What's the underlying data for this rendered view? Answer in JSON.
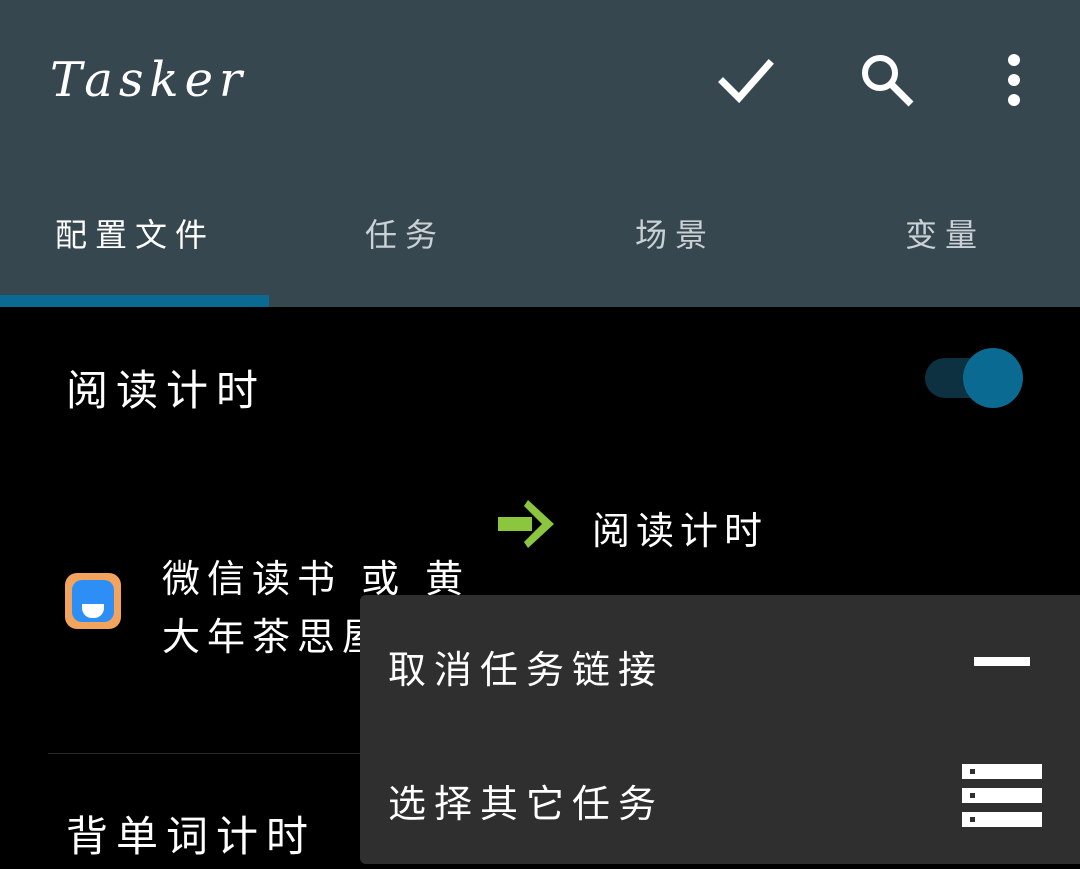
{
  "appbar": {
    "title": "Tasker",
    "actions": [
      {
        "name": "confirm",
        "icon": "check-icon"
      },
      {
        "name": "search",
        "icon": "search-icon"
      },
      {
        "name": "more",
        "icon": "more-vert-icon"
      }
    ],
    "bg_color": "#37474f"
  },
  "tabs": [
    {
      "label": "配置文件",
      "active": true
    },
    {
      "label": "任务",
      "active": false
    },
    {
      "label": "场景",
      "active": false
    },
    {
      "label": "变量",
      "active": false
    }
  ],
  "accent_color": "#0a6a92",
  "profiles": [
    {
      "name": "阅读计时",
      "enabled": true,
      "context_lines": [
        "微信读书 或 黄",
        "大年茶思屋"
      ],
      "context_icon": "weread-app-icon",
      "linked_task": "阅读计时",
      "link_icon": "green-arrow-icon"
    },
    {
      "name": "背单词计时"
    }
  ],
  "context_menu": {
    "items": [
      {
        "label": "取消任务链接",
        "icon": "minus-icon"
      },
      {
        "label": "选择其它任务",
        "icon": "list-icon"
      }
    ]
  }
}
